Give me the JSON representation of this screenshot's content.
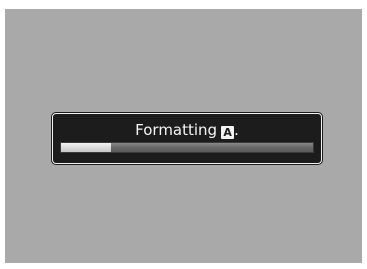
{
  "dialog": {
    "title": "Formatting",
    "drive_letter": "A",
    "title_suffix": ".",
    "drive_icon": "drive-a-icon"
  },
  "progress": {
    "value": 0.2
  },
  "colors": {
    "background": "#a9a9a9",
    "dialog": "#1c1c1c",
    "text": "#f5f5f5",
    "progress_fill": "#e0e0e0",
    "progress_track": "#6a6a6a"
  }
}
